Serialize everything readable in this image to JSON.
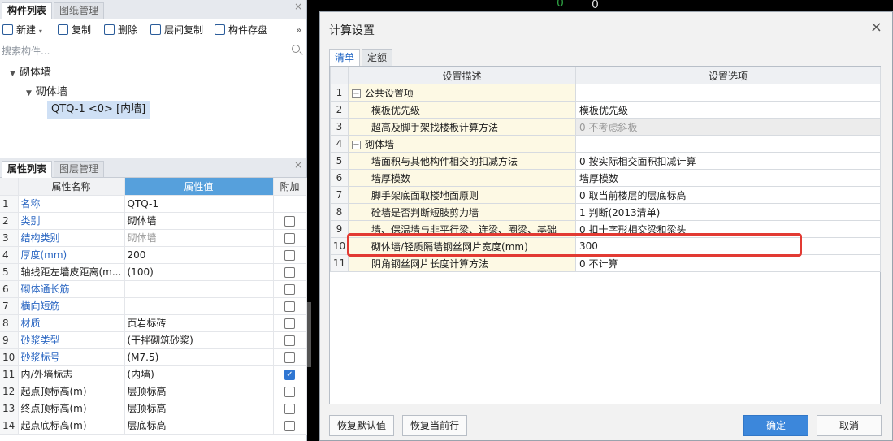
{
  "left_top": {
    "tabs": [
      "构件列表",
      "图纸管理"
    ],
    "toolbar": {
      "new": "新建",
      "copy": "复制",
      "delete": "删除",
      "layer_copy": "层间复制",
      "save": "构件存盘",
      "more": "»"
    },
    "search_placeholder": "搜索构件...",
    "tree": {
      "root": "砌体墙",
      "child": "砌体墙",
      "item": "QTQ-1 <0> [内墙]"
    }
  },
  "left_bottom": {
    "tabs": [
      "属性列表",
      "图层管理"
    ],
    "headers": {
      "name": "属性名称",
      "value": "属性值",
      "extra": "附加"
    },
    "rows": [
      {
        "n": "1",
        "name": "名称",
        "value": "QTQ-1",
        "check": "none"
      },
      {
        "n": "2",
        "name": "类别",
        "value": "砌体墙",
        "check": "off"
      },
      {
        "n": "3",
        "name": "结构类别",
        "value": "砌体墙",
        "check": "off"
      },
      {
        "n": "4",
        "name": "厚度(mm)",
        "value": "200",
        "check": "off"
      },
      {
        "n": "5",
        "name": "轴线距左墙皮距离(m...",
        "value": "(100)",
        "check": "off"
      },
      {
        "n": "6",
        "name": "砌体通长筋",
        "value": "",
        "check": "off"
      },
      {
        "n": "7",
        "name": "横向短筋",
        "value": "",
        "check": "off"
      },
      {
        "n": "8",
        "name": "材质",
        "value": "页岩标砖",
        "check": "off"
      },
      {
        "n": "9",
        "name": "砂浆类型",
        "value": "(干拌砌筑砂浆)",
        "check": "off"
      },
      {
        "n": "10",
        "name": "砂浆标号",
        "value": "(M7.5)",
        "check": "off"
      },
      {
        "n": "11",
        "name": "内/外墙标志",
        "value": "(内墙)",
        "check": "on"
      },
      {
        "n": "12",
        "name": "起点顶标高(m)",
        "value": "层顶标高",
        "check": "off"
      },
      {
        "n": "13",
        "name": "终点顶标高(m)",
        "value": "层顶标高",
        "check": "off"
      },
      {
        "n": "14",
        "name": "起点底标高(m)",
        "value": "层底标高",
        "check": "off"
      }
    ]
  },
  "dialog": {
    "title": "计算设置",
    "close": "×",
    "tabs": [
      "清单",
      "定额"
    ],
    "headers": {
      "desc": "设置描述",
      "opt": "设置选项"
    },
    "rows": [
      {
        "n": "1",
        "desc": "公共设置项",
        "opt": "",
        "group": true
      },
      {
        "n": "2",
        "desc": "模板优先级",
        "opt": "模板优先级"
      },
      {
        "n": "3",
        "desc": "超高及脚手架找楼板计算方法",
        "opt": "0 不考虑斜板",
        "disabled": true
      },
      {
        "n": "4",
        "desc": "砌体墙",
        "opt": "",
        "group": true
      },
      {
        "n": "5",
        "desc": "墙面积与其他构件相交的扣减方法",
        "opt": "0 按实际相交面积扣减计算"
      },
      {
        "n": "6",
        "desc": "墙厚模数",
        "opt": "墙厚模数"
      },
      {
        "n": "7",
        "desc": "脚手架底面取楼地面原则",
        "opt": "0 取当前楼层的层底标高"
      },
      {
        "n": "8",
        "desc": "砼墙是否判断短肢剪力墙",
        "opt": "1 判断(2013清单)"
      },
      {
        "n": "9",
        "desc": "墙、保温墙与非平行梁、连梁、圈梁、基础",
        "opt": "0 扣十字形相交梁和梁头"
      },
      {
        "n": "10",
        "desc": "砌体墙/轻质隔墙钢丝网片宽度(mm)",
        "opt": "300"
      },
      {
        "n": "11",
        "desc": "阴角钢丝网片长度计算方法",
        "opt": "0 不计算"
      }
    ],
    "buttons": {
      "restore_default": "恢复默认值",
      "restore_row": "恢复当前行",
      "ok": "确定",
      "cancel": "取消"
    }
  },
  "background_glyphs": [
    "0",
    "0"
  ]
}
